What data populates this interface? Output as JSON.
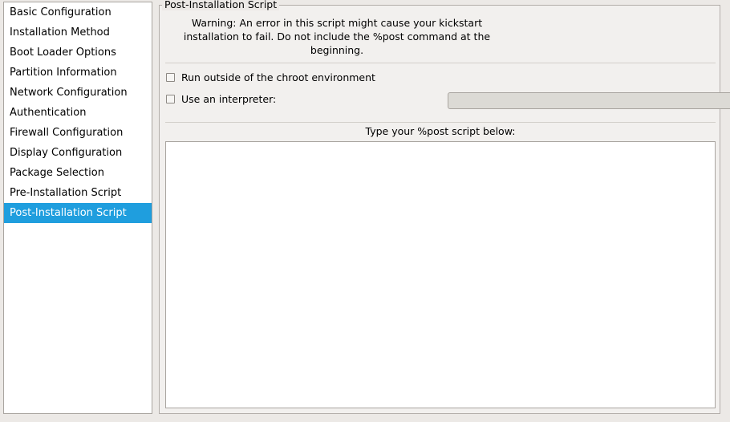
{
  "sidebar": {
    "items": [
      {
        "label": "Basic Configuration",
        "selected": false
      },
      {
        "label": "Installation Method",
        "selected": false
      },
      {
        "label": "Boot Loader Options",
        "selected": false
      },
      {
        "label": "Partition Information",
        "selected": false
      },
      {
        "label": "Network Configuration",
        "selected": false
      },
      {
        "label": "Authentication",
        "selected": false
      },
      {
        "label": "Firewall Configuration",
        "selected": false
      },
      {
        "label": "Display Configuration",
        "selected": false
      },
      {
        "label": "Package Selection",
        "selected": false
      },
      {
        "label": "Pre-Installation Script",
        "selected": false
      },
      {
        "label": "Post-Installation Script",
        "selected": true
      }
    ],
    "selected_index": 10
  },
  "frame": {
    "legend": "Post-Installation Script",
    "warning": "Warning: An error in this script might cause your kickstart installation to fail. Do not include the %post command at the beginning."
  },
  "options": {
    "chroot": {
      "label": "Run outside of the chroot environment",
      "checked": false
    },
    "interpreter": {
      "label": "Use an interpreter:",
      "checked": false,
      "value": "",
      "placeholder": "",
      "enabled": false
    }
  },
  "script": {
    "label": "Type your %post script below:",
    "value": ""
  },
  "colors": {
    "selection": "#1f9ede",
    "selection_text": "#ffffff",
    "window_bg": "#ece9e6",
    "panel_bg": "#f2f0ee",
    "entry_disabled_bg": "#dcdad5",
    "text_bg": "#ffffff",
    "border": "#a9a5a0"
  }
}
